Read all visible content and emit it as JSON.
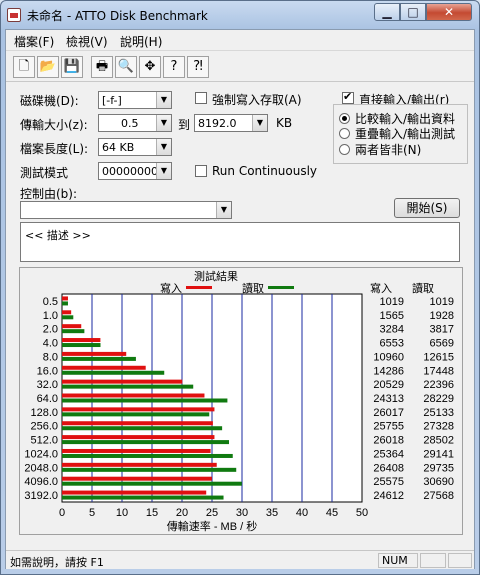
{
  "window": {
    "title": "未命名 - ATTO Disk Benchmark"
  },
  "menu": [
    {
      "label": "檔案(F)"
    },
    {
      "label": "檢視(V)"
    },
    {
      "label": "說明(H)"
    }
  ],
  "toolbar": {
    "icons": [
      "new-icon",
      "open-icon",
      "save-icon",
      "print-icon",
      "print-preview-icon",
      "move-icon",
      "help-icon",
      "context-help-icon"
    ]
  },
  "form": {
    "drive_label": "磁碟機(D):",
    "drive_value": "[-f-]",
    "force_write_label": "強制寫入存取(A)",
    "direct_io_label": "直接輸入/輸出(r)",
    "transfer_size_label": "傳輸大小(z):",
    "transfer_from": "0.5",
    "to_label": "到",
    "transfer_to": "8192.0",
    "kb_label": "KB",
    "file_length_label": "檔案長度(L):",
    "file_length_value": "64 KB",
    "test_pattern_label": "測試模式",
    "test_pattern_value": "00000000",
    "run_continuously_label": "Run Continuously",
    "controlled_by_label": "控制由(b):",
    "controlled_by_value": "",
    "start_button": "開始(S)",
    "description_text": "<<   描述   >>",
    "radio_compare": "比較輸入/輸出資料",
    "radio_overlap": "重疊輸入/輸出測試",
    "radio_neither": "兩者皆非(N)"
  },
  "status": {
    "help_text": "如需說明，請按 F1",
    "num": "NUM"
  },
  "chart_data": {
    "type": "bar",
    "title": "測試結果",
    "xlabel": "傳輸速率 - MB / 秒",
    "categories": [
      "0.5",
      "1.0",
      "2.0",
      "4.0",
      "8.0",
      "16.0",
      "32.0",
      "64.0",
      "128.0",
      "256.0",
      "512.0",
      "1024.0",
      "2048.0",
      "4096.0",
      "3192.0"
    ],
    "series": [
      {
        "name": "寫入",
        "color": "#e01010",
        "values": [
          1019,
          1565,
          3284,
          6553,
          10960,
          14286,
          20529,
          24313,
          26017,
          25755,
          26018,
          25364,
          26408,
          25575,
          24612
        ]
      },
      {
        "name": "讀取",
        "color": "#107a10",
        "values": [
          1019,
          1928,
          3817,
          6569,
          12615,
          17448,
          22396,
          28229,
          25133,
          27328,
          28502,
          29141,
          29735,
          30690,
          27568
        ]
      }
    ],
    "xlim": [
      0,
      50
    ],
    "xticks": [
      "0",
      "5",
      "10",
      "15",
      "20",
      "25",
      "30",
      "35",
      "40",
      "45",
      "50"
    ],
    "column_headers": {
      "write": "寫入",
      "read": "讀取"
    }
  }
}
